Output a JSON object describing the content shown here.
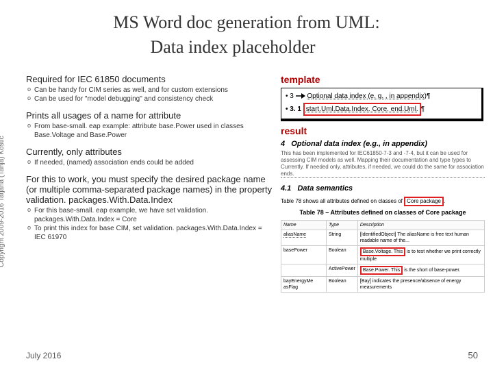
{
  "title": "MS Word doc generation from UML:",
  "subtitle": "Data index placeholder",
  "blocks": [
    {
      "heading": "Required for IEC 61850 documents",
      "items": [
        "Can be handy for CIM series as well, and for custom extensions",
        "Can be used for \"model debugging\" and consistency check"
      ]
    },
    {
      "heading": "Prints all usages of a name for attribute",
      "items": [
        "From base-small. eap example: attribute base.Power used in classes Base.Voltage and Base.Power"
      ]
    },
    {
      "heading": "Currently, only attributes",
      "items": [
        "If needed, (named) association ends could be added"
      ]
    },
    {
      "heading": "For this to work, you must specify the desired package name (or multiple comma-separated package names) in the property validation. packages.With.Data.Index",
      "items": [
        "For this base-small. eap example, we have set validation. packages.With.Data.Index = Core",
        "To print this index for base CIM, set validation. packages.With.Data.Index = IEC 61970"
      ]
    }
  ],
  "template_label": "template",
  "template_line1_prefix": "• 3",
  "template_line1_text": "Optional data index (e. g. , in appendix)",
  "template_line2_prefix": "• 3. 1",
  "template_line2_text": "start.Uml.Data.Index. Core. end.Uml.",
  "result_label": "result",
  "result_heading_num": "4",
  "result_heading_text": "Optional data index (e.g., in appendix)",
  "result_para": "This has been implemented for IEC61850-7-3 and -7-4, but it can be used for assessing CIM models as well. Mapping their documentation and type types to Currently. If needed only, attributes, if needed, we could do the same for association ends.",
  "result_sub_num": "4.1",
  "result_sub_text": "Data semantics",
  "result_caption_pre": "Table 78 shows all attributes defined on classes of",
  "result_caption_box": "Core package",
  "table_caption": "Table 78 – Attributes defined on classes of Core package",
  "table_headers": [
    "Name",
    "Type",
    "Description"
  ],
  "table_rows": [
    {
      "name": "aliasName",
      "type": "String",
      "desc_pre": "[IdentifiedObject] The aliasName is free text human readable name of the...",
      "box": "",
      "desc_post": ""
    },
    {
      "name": "basePower",
      "type": "Boolean",
      "desc_pre": "",
      "box": "Base.Voltage. This",
      "desc_post": " is to test whether we print correctly multiple"
    },
    {
      "name": "",
      "type": "ActivePower",
      "desc_pre": "",
      "box": "Base.Power. This",
      "desc_post": " is the short of base-power."
    },
    {
      "name": "bayEnergyMe asFlag",
      "type": "Boolean",
      "desc_pre": "[Bay] indicates the presence/absence of energy measurements",
      "box": "",
      "desc_post": ""
    }
  ],
  "copyright": "Copyright 2009-2016 Tatjana (Tanja) Kostic",
  "footer_date": "July 2016",
  "footer_page": "50"
}
